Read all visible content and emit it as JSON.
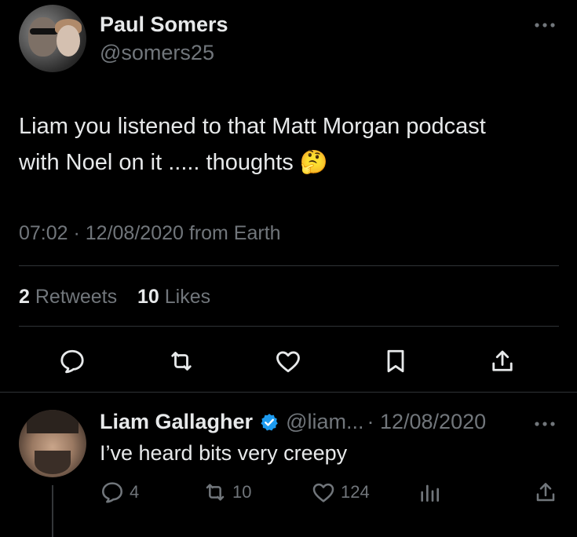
{
  "tweet": {
    "author_name": "Paul Somers",
    "author_handle": "@somers25",
    "text": "Liam you listened to that Matt Morgan podcast with Noel on it ..... thoughts 🤔",
    "meta": "07:02 · 12/08/2020 from Earth",
    "retweets_count": "2",
    "retweets_label": "Retweets",
    "likes_count": "10",
    "likes_label": "Likes",
    "actions": [
      "reply-icon",
      "retweet-icon",
      "like-icon",
      "bookmark-icon",
      "share-icon"
    ],
    "more_icon": "more-icon"
  },
  "reply": {
    "author_name": "Liam Gallagher",
    "verified": true,
    "author_handle": "@liam...",
    "date": "· 12/08/2020",
    "text": "I’ve heard bits very creepy",
    "reply_count": "4",
    "retweet_count": "10",
    "like_count": "124",
    "actions": [
      "reply-icon",
      "retweet-icon",
      "like-icon",
      "views-icon",
      "share-icon"
    ],
    "more_icon": "more-icon"
  },
  "colors": {
    "background": "#000000",
    "text": "#e7e9ea",
    "muted": "#71767b",
    "divider": "#2f3336",
    "verified": "#1d9bf0"
  }
}
